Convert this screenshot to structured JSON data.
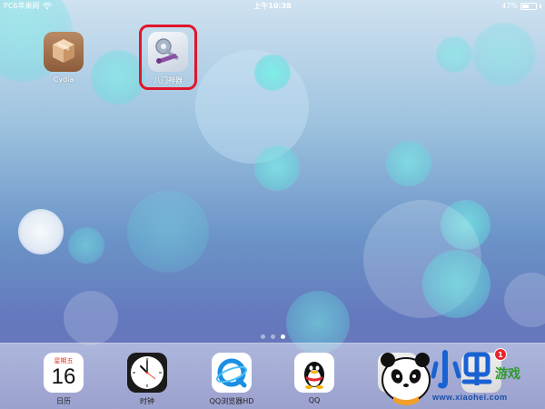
{
  "status_bar": {
    "carrier": "PC6苹果网",
    "time": "上午10:38",
    "battery_percent_text": "47%",
    "battery_level": 0.47
  },
  "home_apps": [
    {
      "label": "Cydia",
      "icon": "cydia-box-icon"
    },
    {
      "label": "八门神器",
      "icon": "key-wrench-icon"
    }
  ],
  "page_indicator": {
    "pages": 3,
    "current": 3
  },
  "dock_apps": [
    {
      "label": "日历",
      "icon": "calendar-icon",
      "weekday": "星期五",
      "day": "16"
    },
    {
      "label": "时钟",
      "icon": "clock-icon"
    },
    {
      "label": "QQ浏览器HD",
      "icon": "qq-browser-icon"
    },
    {
      "label": "QQ",
      "icon": "qq-penguin-icon"
    },
    {
      "label": "",
      "icon": "app-icon",
      "badge": "1"
    }
  ],
  "watermark": {
    "logo_text": "小黑游戏",
    "url": "www.xiaohei.com"
  },
  "colors": {
    "highlight": "#e0152a",
    "badge": "#e8262e",
    "calendar_red": "#e23b2b"
  }
}
